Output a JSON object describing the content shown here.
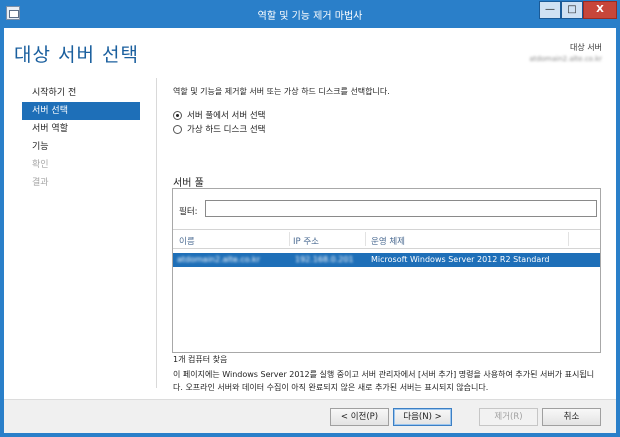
{
  "window": {
    "title": "역할 및 기능 제거 마법사",
    "min_glyph": "—",
    "max_glyph": "□",
    "close_glyph": "X"
  },
  "header": {
    "page_title": "대상 서버 선택",
    "destination_label": "대상 서버",
    "destination_server": "atdomain2.alte.co.kr"
  },
  "nav": {
    "items": [
      {
        "label": "시작하기 전",
        "state": "normal"
      },
      {
        "label": "서버 선택",
        "state": "active"
      },
      {
        "label": "서버 역할",
        "state": "normal"
      },
      {
        "label": "기능",
        "state": "normal"
      },
      {
        "label": "확인",
        "state": "disabled"
      },
      {
        "label": "결과",
        "state": "disabled"
      }
    ]
  },
  "main": {
    "description": "역할 및 기능을 제거할 서버 또는 가상 하드 디스크를 선택합니다.",
    "radio_options": [
      {
        "label": "서버 풀에서 서버 선택",
        "selected": true
      },
      {
        "label": "가상 하드 디스크 선택",
        "selected": false
      }
    ],
    "pool_title": "서버 풀",
    "filter_label": "필터:",
    "filter_value": "",
    "columns": [
      "이름",
      "IP 주소",
      "운영 체제"
    ],
    "rows": [
      {
        "name": "atdomain2.alte.co.kr",
        "ip": "192.168.0.201",
        "os": "Microsoft Windows Server 2012 R2 Standard",
        "selected": true
      }
    ],
    "count_text": "1개 컴퓨터 찾음",
    "note": "이 페이지에는 Windows Server 2012를 실행 중이고 서버 관리자에서 [서버 추가] 명령을 사용하여 추가된 서버가 표시됩니다. 오프라인 서버와 데이터 수집이 아직 완료되지 않은 새로 추가된 서버는 표시되지 않습니다."
  },
  "footer": {
    "prev_label": "< 이전(P)",
    "next_label": "다음(N) >",
    "remove_label": "제거(R)",
    "cancel_label": "취소"
  },
  "colors": {
    "accent": "#1e6fb8",
    "title_text": "#1a5f9e",
    "window_frame": "#2a7fc9"
  }
}
